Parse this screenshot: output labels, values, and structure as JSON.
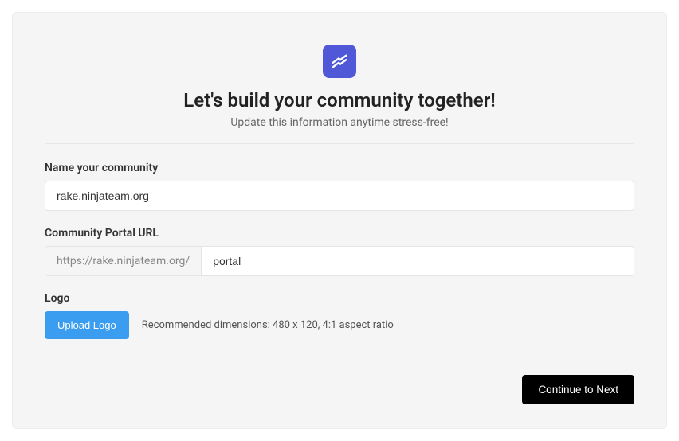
{
  "header": {
    "title": "Let's build your community together!",
    "subtitle": "Update this information anytime stress-free!"
  },
  "form": {
    "name_label": "Name your community",
    "name_value": "rake.ninjateam.org",
    "url_label": "Community Portal URL",
    "url_prefix": "https://rake.ninjateam.org/",
    "url_value": "portal",
    "logo_label": "Logo",
    "upload_button": "Upload Logo",
    "upload_hint": "Recommended dimensions: 480 x 120, 4:1 aspect ratio"
  },
  "footer": {
    "continue_button": "Continue to Next"
  }
}
